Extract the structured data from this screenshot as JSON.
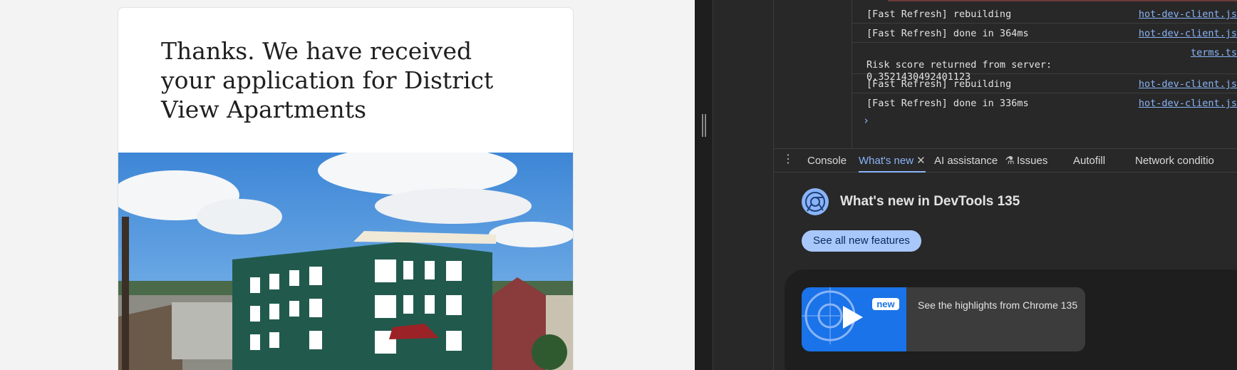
{
  "page": {
    "heading": "Thanks. We have received your application for District View Apartments"
  },
  "console": {
    "logs": [
      {
        "message": "[Fast Refresh] rebuilding",
        "source": "hot-dev-client.js"
      },
      {
        "message": "[Fast Refresh] done in 364ms",
        "source": "hot-dev-client.js"
      },
      {
        "message": "Risk score returned from server:\n0.3521430492401123",
        "source": "terms.ts"
      },
      {
        "message": "[Fast Refresh] rebuilding",
        "source": "hot-dev-client.js"
      },
      {
        "message": "[Fast Refresh] done in 336ms",
        "source": "hot-dev-client.js"
      }
    ],
    "prompt": "›"
  },
  "tabs": {
    "console": "Console",
    "whats_new": "What's new",
    "ai_assistance": "AI assistance",
    "issues": "Issues",
    "autofill": "Autofill",
    "network_conditions": "Network conditio"
  },
  "whats_new": {
    "title": "What's new in DevTools 135",
    "see_all": "See all new features",
    "badge": "new",
    "highlight_text": "See the highlights from Chrome 135"
  },
  "colors": {
    "accent": "#8ab4f8",
    "button_bg": "#a8c7fa"
  }
}
